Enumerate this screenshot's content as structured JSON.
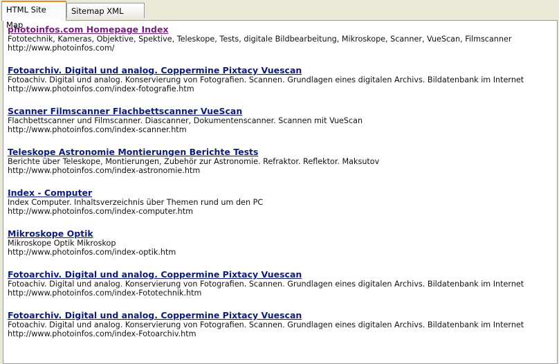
{
  "tabs": [
    {
      "label": "HTML Site Map",
      "active": true
    },
    {
      "label": "Sitemap XML Index",
      "active": false
    }
  ],
  "entries": [
    {
      "title": "photoinfos.com Homepage Index",
      "description": "Fototechnik, Kameras, Objektive, Spektive, Teleskope, Tests, digitale Bildbearbeitung, Mikroskope, Scanner, VueScan, Filmscanner",
      "url": "http://www.photoinfos.com/",
      "visited": true
    },
    {
      "title": "Fotoarchiv. Digital und analog. Coppermine Pixtacy Vuescan",
      "description": "Fotoachiv. Digital und analog. Konservierung von Fotografien. Scannen. Grundlagen eines digitalen Archivs. Bildatenbank im Internet",
      "url": "http://www.photoinfos.com/index-fotografie.htm",
      "visited": false
    },
    {
      "title": "Scanner Filmscanner Flachbettscanner VueScan",
      "description": "Flachbettscanner und Filmscanner. Diascanner, Dokumentenscanner. Scannen mit VueScan",
      "url": "http://www.photoinfos.com/index-scanner.htm",
      "visited": false
    },
    {
      "title": "Teleskope Astronomie Montierungen Berichte Tests",
      "description": "Berichte über Teleskope, Montierungen, Zubehör zur Astronomie. Refraktor. Reflektor. Maksutov",
      "url": "http://www.photoinfos.com/index-astronomie.htm",
      "visited": false
    },
    {
      "title": "Index - Computer",
      "description": "Index Computer. Inhaltsverzeichnis über Themen rund um den PC",
      "url": "http://www.photoinfos.com/index-computer.htm",
      "visited": false
    },
    {
      "title": "Mikroskope Optik",
      "description": "Mikroskope Optik Mikroskop",
      "url": "http://www.photoinfos.com/index-optik.htm",
      "visited": false
    },
    {
      "title": "Fotoarchiv. Digital und analog. Coppermine Pixtacy Vuescan",
      "description": "Fotoachiv. Digital und analog. Konservierung von Fotografien. Scannen. Grundlagen eines digitalen Archivs. Bildatenbank im Internet",
      "url": "http://www.photoinfos.com/index-Fototechnik.htm",
      "visited": false
    },
    {
      "title": "Fotoarchiv. Digital und analog. Coppermine Pixtacy Vuescan",
      "description": "Fotoachiv. Digital und analog. Konservierung von Fotografien. Scannen. Grundlagen eines digitalen Archivs. Bildatenbank im Internet",
      "url": "http://www.photoinfos.com/index-Fotoarchiv.htm",
      "visited": false
    }
  ],
  "colors": {
    "link": "#0d1c78",
    "visited_link": "#7a1e82",
    "active_tab_accent": "#e68b2c"
  }
}
